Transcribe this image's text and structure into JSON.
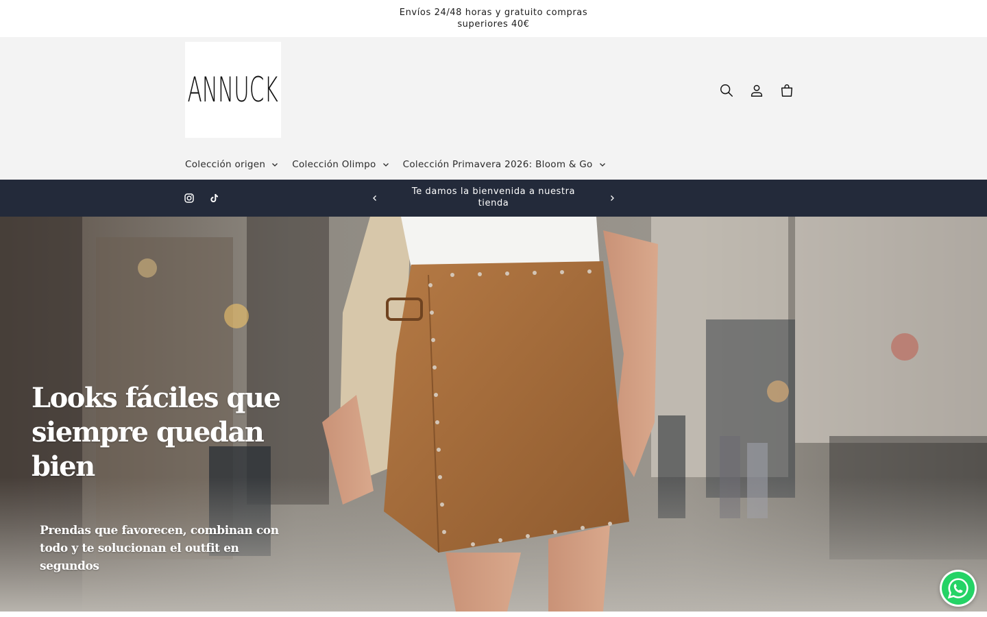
{
  "announcement": {
    "text": "Envíos 24/48 horas y gratuito compras superiores 40€"
  },
  "header": {
    "logo_text": "ANNUCK",
    "icons": [
      "search-icon",
      "account-icon",
      "cart-icon"
    ]
  },
  "nav": {
    "items": [
      {
        "label": "Colección origen"
      },
      {
        "label": "Colección Olimpo"
      },
      {
        "label": "Colección Primavera 2026: Bloom & Go"
      }
    ]
  },
  "bar": {
    "message": "Te damos la bienvenida a nuestra tienda",
    "social": [
      "instagram-icon",
      "tiktok-icon"
    ]
  },
  "hero": {
    "title": "Looks fáciles que siempre quedan bien",
    "subtitle": "Prendas que favorecen, combinan con todo y te solucionan el outfit en segundos"
  },
  "colors": {
    "header_bg": "#f3f3f3",
    "bar_bg": "#232a3a",
    "whatsapp": "#25d366"
  }
}
